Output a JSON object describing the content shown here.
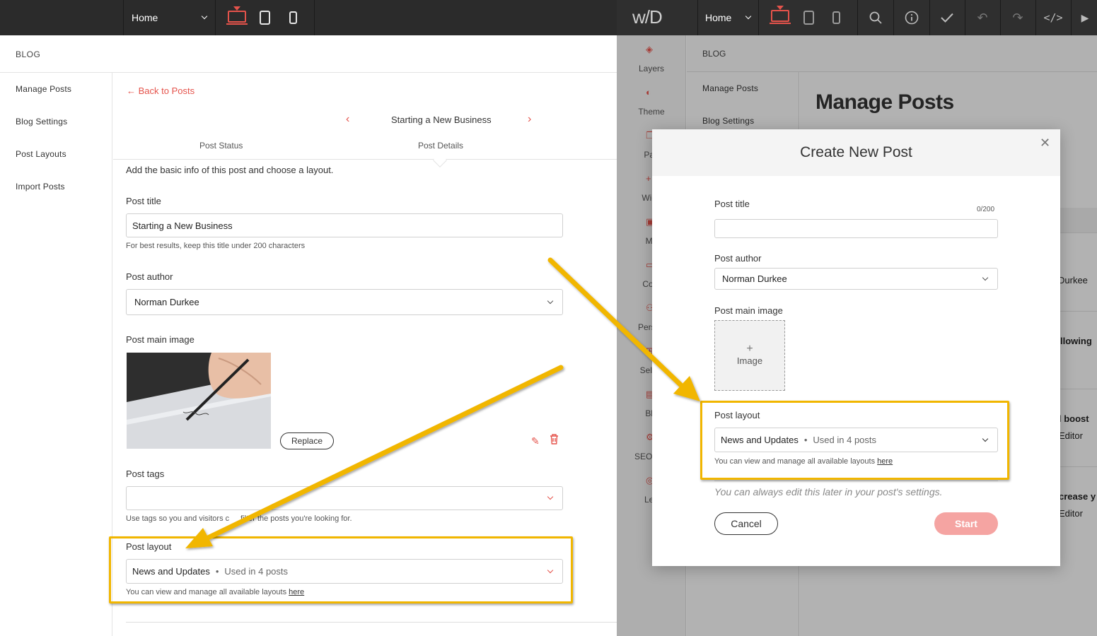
{
  "left_editor": {
    "toolbar": {
      "page_select": "Home"
    },
    "blog_header": "BLOG",
    "sidebar": {
      "items": [
        {
          "label": "Manage Posts"
        },
        {
          "label": "Blog Settings"
        },
        {
          "label": "Post Layouts"
        },
        {
          "label": "Import Posts"
        }
      ]
    },
    "back_link": "Back to Posts",
    "post_nav": {
      "title": "Starting a New Business"
    },
    "tabs": [
      {
        "label": "Post Status"
      },
      {
        "label": "Post Details"
      }
    ],
    "intro": "Add the basic info of this post and choose a layout.",
    "post_title": {
      "label": "Post title",
      "value": "Starting a New Business",
      "hint": "For best results, keep this title under 200 characters"
    },
    "post_author": {
      "label": "Post author",
      "value": "Norman Durkee"
    },
    "post_main_image": {
      "label": "Post main image",
      "replace_label": "Replace"
    },
    "post_tags": {
      "label": "Post tags",
      "value": "",
      "hint_before": "Use tags so you and visitors c",
      "hint_after": "filter the posts you're looking for."
    },
    "post_layout": {
      "label": "Post layout",
      "value": "News and Updates",
      "usage": "Used in 4 posts",
      "hint": "You can view and manage all available layouts",
      "hint_link": "here"
    }
  },
  "right_editor": {
    "logo": "w/D",
    "toolbar": {
      "page_select": "Home"
    },
    "rail": {
      "items": [
        {
          "label": "Layers"
        },
        {
          "label": "Theme"
        },
        {
          "label": "Pag"
        },
        {
          "label": "Widg"
        },
        {
          "label": "Me"
        },
        {
          "label": "Cont"
        },
        {
          "label": "Person"
        },
        {
          "label": "Sell O"
        },
        {
          "label": "Blo"
        },
        {
          "label": "SEO & S"
        },
        {
          "label": "Lea"
        }
      ]
    },
    "blog_header": "BLOG",
    "sidebar": {
      "items": [
        {
          "label": "Manage Posts"
        },
        {
          "label": "Blog Settings"
        }
      ]
    },
    "main_title": "Manage Posts",
    "background_snippets": [
      {
        "text": "Durkee"
      },
      {
        "text": "llowing"
      },
      {
        "text": "l boost"
      },
      {
        "text": "Editor"
      },
      {
        "text": "crease y"
      },
      {
        "text": "Editor"
      }
    ],
    "modal": {
      "title": "Create New Post",
      "post_title": {
        "label": "Post title",
        "counter": "0/200",
        "value": ""
      },
      "post_author": {
        "label": "Post author",
        "value": "Norman Durkee"
      },
      "post_main_image": {
        "label": "Post main image",
        "placeholder": "Image"
      },
      "post_layout": {
        "label": "Post layout",
        "value": "News and Updates",
        "usage": "Used in 4 posts",
        "hint": "You can view and manage all available layouts",
        "hint_link": "here"
      },
      "note": "You can always edit this later in your post's settings.",
      "cancel_label": "Cancel",
      "start_label": "Start"
    }
  },
  "colors": {
    "accent_red": "#e5534b",
    "highlight_yellow": "#f1b600",
    "toolbar_dark": "#2b2b2b",
    "start_disabled": "#f5a4a2"
  }
}
